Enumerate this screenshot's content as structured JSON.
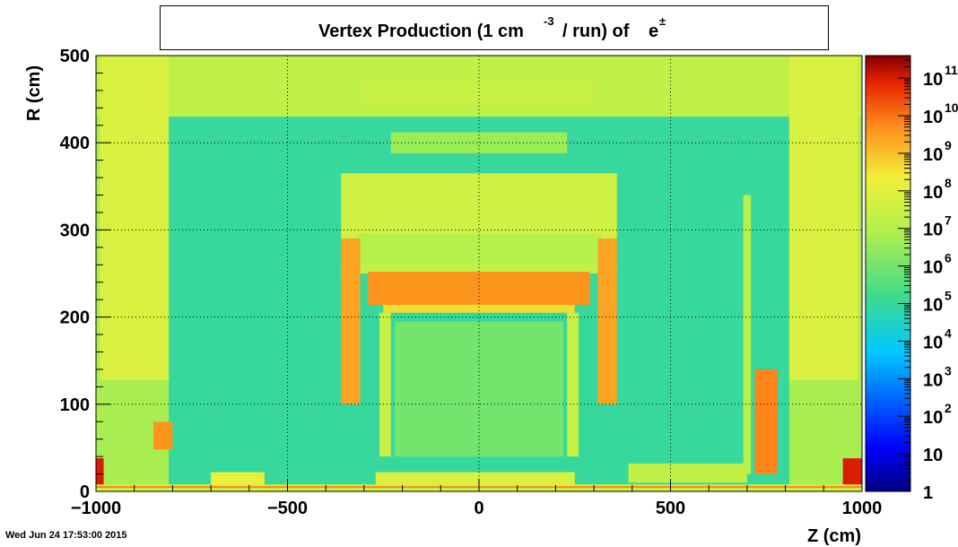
{
  "chart_data": {
    "type": "heatmap",
    "title": {
      "part1": "Vertex Production (1 cm",
      "exponent": "-3",
      "part2": "/ run) of",
      "particle": "e",
      "particle_sup": "±"
    },
    "xlabel": "Z (cm)",
    "ylabel": "R (cm)",
    "xlim": [
      -1000,
      1000
    ],
    "ylim": [
      0,
      500
    ],
    "x_ticks": [
      -1000,
      -500,
      0,
      500,
      1000
    ],
    "x_tick_labels": [
      "−1000",
      "−500",
      "0",
      "500",
      "1000"
    ],
    "y_ticks": [
      0,
      100,
      200,
      300,
      400,
      500
    ],
    "y_tick_labels": [
      "0",
      "100",
      "200",
      "300",
      "400",
      "500"
    ],
    "grid": true,
    "colorbar": {
      "scale": "log",
      "range_exponents": [
        0,
        11.6
      ],
      "labels": [
        {
          "text": "1",
          "exp": ""
        },
        {
          "text": "10",
          "exp": ""
        },
        {
          "text": "10",
          "exp": "2"
        },
        {
          "text": "10",
          "exp": "3"
        },
        {
          "text": "10",
          "exp": "4"
        },
        {
          "text": "10",
          "exp": "5"
        },
        {
          "text": "10",
          "exp": "6"
        },
        {
          "text": "10",
          "exp": "7"
        },
        {
          "text": "10",
          "exp": "8"
        },
        {
          "text": "10",
          "exp": "9"
        },
        {
          "text": "10",
          "exp": "10"
        },
        {
          "text": "10",
          "exp": "11"
        }
      ]
    },
    "background_log10": 6.8,
    "regions": [
      {
        "z": [
          -1000,
          1000
        ],
        "r": [
          430,
          500
        ],
        "v": 7.2
      },
      {
        "z": [
          -810,
          810
        ],
        "r": [
          0,
          430
        ],
        "v": 5.0
      },
      {
        "z": [
          -990,
          -810
        ],
        "r": [
          128,
          500
        ],
        "v": 7.8
      },
      {
        "z": [
          810,
          990
        ],
        "r": [
          128,
          500
        ],
        "v": 7.8
      },
      {
        "z": [
          -310,
          310
        ],
        "r": [
          445,
          472
        ],
        "v": 7.4
      },
      {
        "z": [
          -230,
          230
        ],
        "r": [
          388,
          412
        ],
        "v": 6.6
      },
      {
        "z": [
          -360,
          360
        ],
        "r": [
          290,
          365
        ],
        "v": 7.6
      },
      {
        "z": [
          -320,
          320
        ],
        "r": [
          262,
          296
        ],
        "v": 7.0
      },
      {
        "z": [
          -360,
          360
        ],
        "r": [
          250,
          262
        ],
        "v": 7.3
      },
      {
        "z": [
          -290,
          290
        ],
        "r": [
          214,
          252
        ],
        "v": 9.6
      },
      {
        "z": [
          -250,
          250
        ],
        "r": [
          205,
          214
        ],
        "v": 8.6
      },
      {
        "z": [
          -360,
          -310
        ],
        "r": [
          100,
          290
        ],
        "v": 9.4
      },
      {
        "z": [
          310,
          360
        ],
        "r": [
          100,
          290
        ],
        "v": 9.4
      },
      {
        "z": [
          -260,
          -230
        ],
        "r": [
          40,
          205
        ],
        "v": 7.4
      },
      {
        "z": [
          230,
          260
        ],
        "r": [
          40,
          205
        ],
        "v": 7.4
      },
      {
        "z": [
          -220,
          220
        ],
        "r": [
          40,
          195
        ],
        "v": 6.0
      },
      {
        "z": [
          -270,
          250
        ],
        "r": [
          2,
          22
        ],
        "v": 7.8
      },
      {
        "z": [
          -700,
          -560
        ],
        "r": [
          5,
          22
        ],
        "v": 8.2
      },
      {
        "z": [
          390,
          700
        ],
        "r": [
          10,
          32
        ],
        "v": 7.2
      },
      {
        "z": [
          -850,
          -800
        ],
        "r": [
          48,
          80
        ],
        "v": 9.6
      },
      {
        "z": [
          720,
          780
        ],
        "r": [
          20,
          140
        ],
        "v": 9.8
      },
      {
        "z": [
          690,
          710
        ],
        "r": [
          20,
          340
        ],
        "v": 7.0
      },
      {
        "z": [
          -1000,
          -980
        ],
        "r": [
          5,
          38
        ],
        "v": 11.0
      },
      {
        "z": [
          950,
          1000
        ],
        "r": [
          5,
          38
        ],
        "v": 11.0
      },
      {
        "z": [
          -1000,
          1000
        ],
        "r": [
          0,
          8
        ],
        "v": 7.6
      },
      {
        "z": [
          -1000,
          1000
        ],
        "r": [
          4,
          6
        ],
        "v": 9.8
      }
    ]
  },
  "footer": {
    "timestamp": "Wed Jun 24 17:53:00 2015"
  }
}
